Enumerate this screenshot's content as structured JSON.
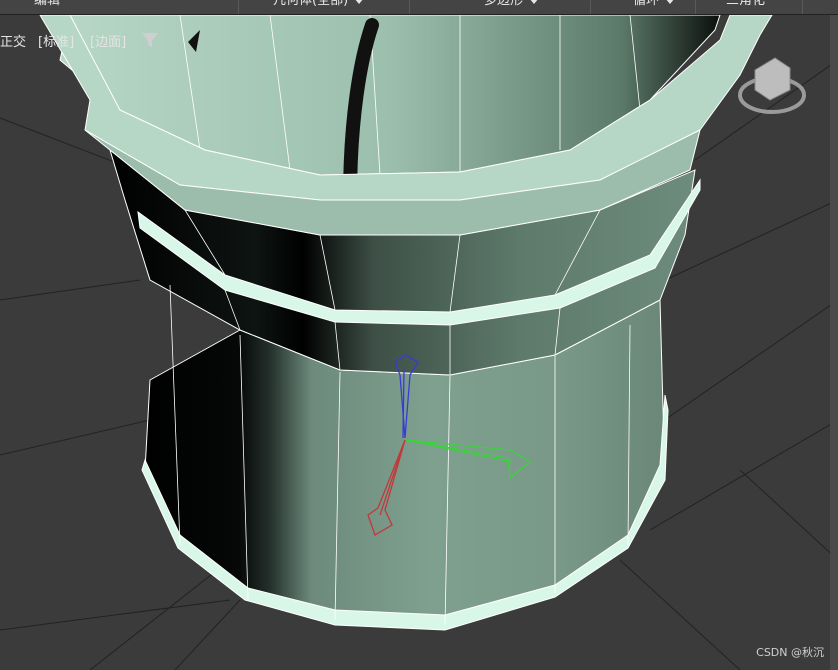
{
  "menubar": {
    "items": [
      {
        "label": "编辑",
        "has_arrow": false
      },
      {
        "label": "几何体(全部)",
        "has_arrow": true
      },
      {
        "label": "多边形",
        "has_arrow": true
      },
      {
        "label": "循环",
        "has_arrow": true
      },
      {
        "label": "三角化",
        "has_arrow": false
      }
    ]
  },
  "viewport": {
    "labels": {
      "view": "正交",
      "shading": "[标准]",
      "mode": "[边面]"
    }
  },
  "gizmo": {
    "axes": [
      "z-axis-blue",
      "y-axis-green",
      "x-axis-red"
    ]
  },
  "watermark": "CSDN @秋沉",
  "colors": {
    "mesh_face": "#7fa08f",
    "mesh_highlight": "#d8f7e8",
    "background": "#3b3b3b",
    "axis_x": "#c0393b",
    "axis_y": "#3cd23c",
    "axis_z": "#3a3ad8"
  }
}
